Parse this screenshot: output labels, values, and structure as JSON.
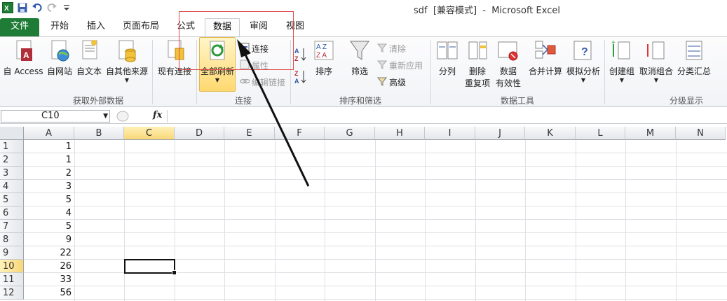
{
  "window": {
    "title": "sdf  [兼容模式]  -  Microsoft Excel"
  },
  "qat": {
    "icons": [
      "excel-logo-icon",
      "save-icon",
      "undo-icon",
      "redo-icon",
      "customize-qat-icon"
    ]
  },
  "tabs": [
    {
      "label": "文件"
    },
    {
      "label": "开始"
    },
    {
      "label": "插入"
    },
    {
      "label": "页面布局"
    },
    {
      "label": "公式"
    },
    {
      "label": "数据"
    },
    {
      "label": "审阅"
    },
    {
      "label": "视图"
    }
  ],
  "ribbon": {
    "groups": {
      "external": "获取外部数据",
      "connections": "连接",
      "sort_filter": "排序和筛选",
      "data_tools": "数据工具",
      "outline": "分级显示"
    },
    "buttons": {
      "from_access": "自 Access",
      "from_web": "自网站",
      "from_text": "自文本",
      "from_other": "自其他来源",
      "existing": "现有连接",
      "refresh_all": "全部刷新",
      "connections": "连接",
      "properties": "属性",
      "edit_links": "编辑链接",
      "sort": "排序",
      "filter": "筛选",
      "clear": "清除",
      "reapply": "重新应用",
      "advanced": "高级",
      "text_to_columns": "分列",
      "remove_dup_1": "删除",
      "remove_dup_2": "重复项",
      "validation_1": "数据",
      "validation_2": "有效性",
      "consolidate": "合并计算",
      "whatif": "模拟分析",
      "group": "创建组",
      "ungroup": "取消组合",
      "subtotal": "分类汇总"
    }
  },
  "formula_bar": {
    "name_box": "C10",
    "fx": "fx",
    "value": ""
  },
  "grid": {
    "columns": [
      "A",
      "B",
      "C",
      "D",
      "E",
      "F",
      "G",
      "H",
      "I",
      "J",
      "K",
      "L",
      "M",
      "N"
    ],
    "selected_column": "C",
    "rows": [
      {
        "n": "1",
        "a": "1"
      },
      {
        "n": "2",
        "a": "1"
      },
      {
        "n": "3",
        "a": "2"
      },
      {
        "n": "4",
        "a": "3"
      },
      {
        "n": "5",
        "a": "5"
      },
      {
        "n": "6",
        "a": "4"
      },
      {
        "n": "7",
        "a": "5"
      },
      {
        "n": "8",
        "a": "9"
      },
      {
        "n": "9",
        "a": "22"
      },
      {
        "n": "10",
        "a": "26"
      },
      {
        "n": "11",
        "a": "33"
      },
      {
        "n": "12",
        "a": "56"
      }
    ],
    "selected_row": "10"
  },
  "colors": {
    "file_tab": "#1f7c36",
    "annotation": "#e04848",
    "selection": "#f9d778"
  }
}
